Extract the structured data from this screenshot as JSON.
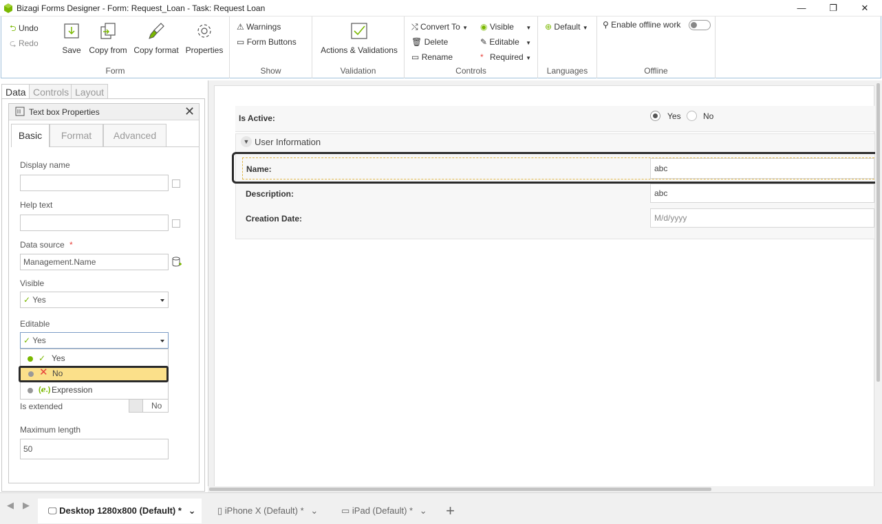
{
  "window": {
    "title": "Bizagi Forms Designer  - Form: Request_Loan - Task:  Request Loan",
    "minimize": "—",
    "restore": "❐",
    "close": "✕"
  },
  "ribbon": {
    "undo": "Undo",
    "redo": "Redo",
    "save": "Save",
    "copy_from": "Copy from",
    "copy_format": "Copy format",
    "properties": "Properties",
    "group_form": "Form",
    "warnings": "Warnings",
    "form_buttons": "Form Buttons",
    "group_show": "Show",
    "actions_validations": "Actions & Validations",
    "group_validation": "Validation",
    "convert_to": "Convert To",
    "delete": "Delete",
    "rename": "Rename",
    "visible": "Visible",
    "editable": "Editable",
    "required": "Required",
    "group_controls": "Controls",
    "default": "Default",
    "group_languages": "Languages",
    "enable_offline": "Enable offline work",
    "group_offline": "Offline"
  },
  "left_tabs": [
    "Data",
    "Controls",
    "Layout"
  ],
  "props": {
    "title": "Text box Properties",
    "tabs": [
      "Basic",
      "Format",
      "Advanced"
    ],
    "display_name_label": "Display name",
    "help_text_label": "Help text",
    "data_source_label": "Data source",
    "data_source_required": "*",
    "data_source_value": "Management.Name",
    "visible_label": "Visible",
    "visible_value": "Yes",
    "editable_label": "Editable",
    "editable_value": "Yes",
    "editable_options": [
      "Yes",
      "No",
      "Expression"
    ],
    "is_extended_label": "Is extended",
    "is_extended_value": "No",
    "max_length_label": "Maximum length",
    "max_length_value": "50"
  },
  "form": {
    "is_active_label": "Is Active:",
    "radio_yes": "Yes",
    "radio_no": "No",
    "group_title": "User Information",
    "name_label": "Name:",
    "name_value": "abc",
    "description_label": "Description:",
    "description_value": "abc",
    "creation_date_label": "Creation Date:",
    "creation_date_placeholder": "M/d/yyyy"
  },
  "bottom_tabs": [
    {
      "label": "Desktop 1280x800 (Default)",
      "modified": "*"
    },
    {
      "label": "iPhone X (Default)",
      "modified": "*"
    },
    {
      "label": "iPad (Default)",
      "modified": "*"
    }
  ],
  "bottom_add": "+",
  "colors": {
    "accent_green": "#7ab800",
    "highlight_yellow": "#fbe08a",
    "required_red": "#e8403a",
    "focus_border": "#333333"
  }
}
